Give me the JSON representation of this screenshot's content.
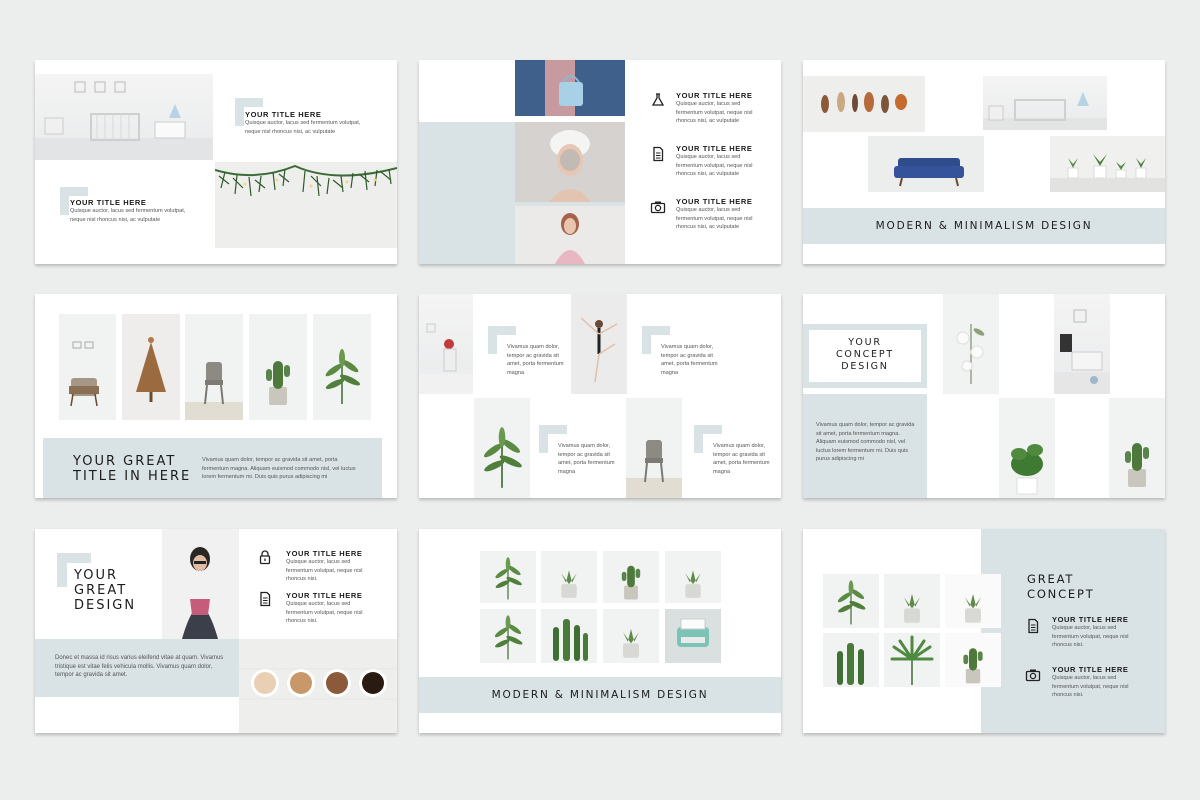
{
  "colors": {
    "background": "#eceeee",
    "accent_band": "#d9e2e4",
    "text": "#1c1c1c"
  },
  "slide1": {
    "title_a": "YOUR TITLE HERE",
    "body_a": "Quisque auctor, lacus sed fermentum volutpat, neque nisl rhoncus nisi, ac vulputate",
    "title_b": "YOUR TITLE HERE",
    "body_b": "Quisque auctor, lacus sed fermentum volutpat, neque nisl rhoncus nisi, ac vulputate"
  },
  "slide2": {
    "items": [
      {
        "icon": "flask-icon",
        "title": "YOUR TITLE HERE",
        "body": "Quisque auctor, lacus sed fermentum volutpat, neque nisl rhoncus nisi, ac vulputate"
      },
      {
        "icon": "document-icon",
        "title": "YOUR TITLE HERE",
        "body": "Quisque auctor, lacus sed fermentum volutpat, neque nisl rhoncus nisi, ac vulputate"
      },
      {
        "icon": "camera-icon",
        "title": "YOUR TITLE HERE",
        "body": "Quisque auctor, lacus sed fermentum volutpat, neque nisl rhoncus nisi, ac vulputate"
      }
    ]
  },
  "slide3": {
    "banner": "MODERN & MINIMALISM DESIGN"
  },
  "slide4": {
    "title_line1": "YOUR GREAT",
    "title_line2": "TITLE IN HERE",
    "body": "Vivamus quam dolor, tempor ac gravida sit amet, porta fermentum magna. Aliquam euismod commodo nisl, vel luctus lorem fermentum mi. Duis quis purus adipiscing mi"
  },
  "slide5": {
    "captions": [
      "Vivamus quam dolor, tempor ac gravida sit amet, porta fermentum magna",
      "Vivamus quam dolor, tempor ac gravida sit amet, porta fermentum magna",
      "Vivamus quam dolor, tempor ac gravida sit amet, porta fermentum magna",
      "Vivamus quam dolor, tempor ac gravida sit amet, porta fermentum magna"
    ]
  },
  "slide6": {
    "title_line1": "YOUR",
    "title_line2": "CONCEPT",
    "title_line3": "DESIGN",
    "body": "Vivamus quam dolor, tempor ac gravida sit amet, porta fermentum magna. Aliquam euismod commodo nisl, vel luctus lorem fermentum mi. Duis quis purus adipiscing mi"
  },
  "slide7": {
    "title_line1": "YOUR",
    "title_line2": "GREAT",
    "title_line3": "DESIGN",
    "body": "Donec et massa id risus varius eleifend vitae at quam. Vivamus tristique est vitae felis vehicula mollis. Vivamus quam dolor, tempor ac gravida sit amet.",
    "items": [
      {
        "icon": "lock-icon",
        "title": "YOUR TITLE HERE",
        "body": "Quisque auctor, lacus sed fermentum volutpat, neque nisl rhoncus nisi."
      },
      {
        "icon": "document-icon",
        "title": "YOUR TITLE HERE",
        "body": "Quisque auctor, lacus sed fermentum volutpat, neque nisl rhoncus nisi."
      }
    ]
  },
  "slide8": {
    "banner": "MODERN & MINIMALISM DESIGN"
  },
  "slide9": {
    "title_line1": "GREAT",
    "title_line2": "CONCEPT",
    "items": [
      {
        "icon": "document-icon",
        "title": "YOUR TITLE HERE",
        "body": "Quisque auctor, lacus sed fermentum volutpat, neque nisl rhoncus nisi."
      },
      {
        "icon": "camera-icon",
        "title": "YOUR TITLE HERE",
        "body": "Quisque auctor, lacus sed fermentum volutpat, neque nisl rhoncus nisi."
      }
    ]
  }
}
